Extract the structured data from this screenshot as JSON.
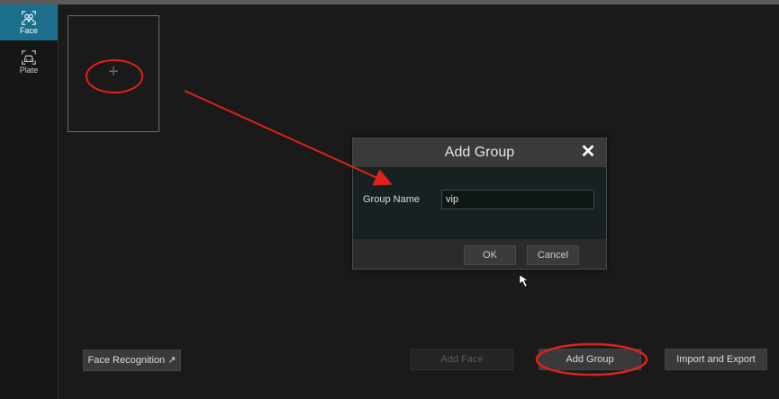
{
  "sidebar": {
    "items": [
      {
        "label": "Face",
        "icon": "face-icon",
        "active": true
      },
      {
        "label": "Plate",
        "icon": "car-icon",
        "active": false
      }
    ]
  },
  "main": {
    "add_card": {
      "icon": "plus-icon"
    },
    "buttons": {
      "face_recognition": "Face Recognition",
      "add_face": "Add Face",
      "add_group": "Add Group",
      "import_export": "Import and Export"
    }
  },
  "dialog": {
    "title": "Add Group",
    "close_icon": "close-icon",
    "group_name_label": "Group Name",
    "group_name_value": "vip",
    "ok_label": "OK",
    "cancel_label": "Cancel"
  },
  "colors": {
    "accent_active": "#1b6e8c",
    "annotation": "#e0201a"
  }
}
